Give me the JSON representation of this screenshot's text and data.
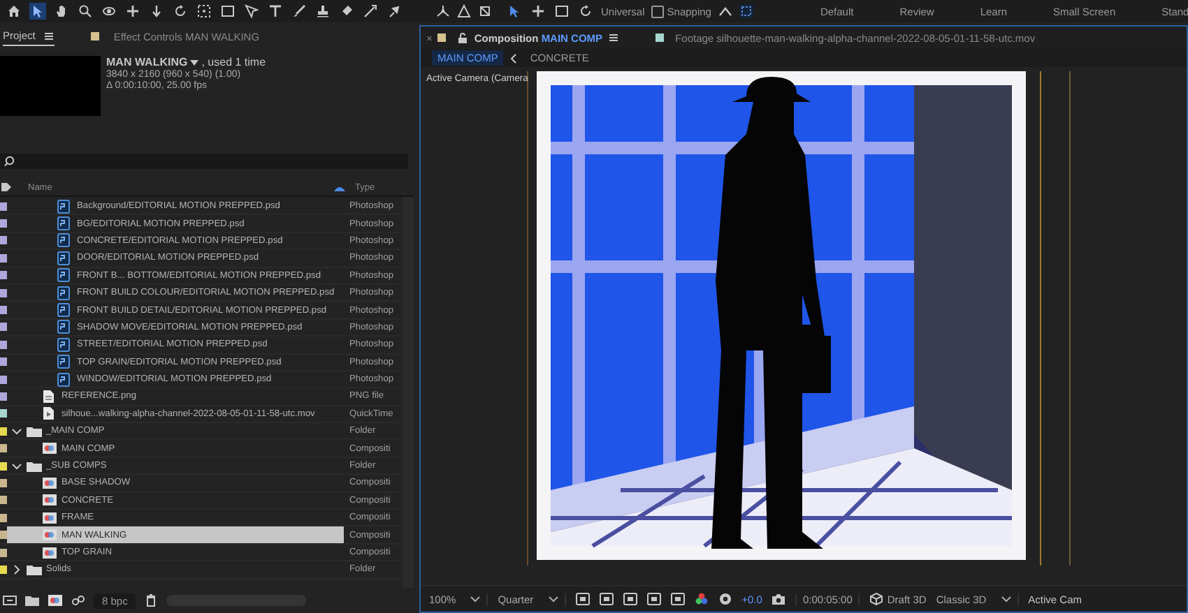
{
  "toolbar": {
    "tools": [
      {
        "selected": false
      },
      {
        "selected": true
      },
      {
        "selected": false
      },
      {
        "selected": false
      },
      {
        "selected": false
      },
      {
        "selected": false
      },
      {
        "selected": false
      },
      {
        "selected": false
      },
      {
        "selected": false
      },
      {
        "selected": false
      },
      {
        "selected": false
      },
      {
        "selected": false
      },
      {
        "selected": false
      },
      {
        "selected": false
      },
      {
        "selected": false
      },
      {
        "selected": false
      },
      {
        "selected": false
      }
    ],
    "view_tools": [
      {
        "selected": true
      },
      {
        "selected": false
      },
      {
        "selected": false
      },
      {
        "selected": false
      }
    ],
    "axis_mode": "Universal",
    "snapping": {
      "label": "Snapping",
      "checked": false
    },
    "workspaces": [
      "Default",
      "Review",
      "Learn",
      "Small Screen",
      "Stand"
    ]
  },
  "project_panel": {
    "tabs": [
      {
        "label": "Project",
        "selected": true
      },
      {
        "label": "Effect Controls MAN WALKING",
        "selected": false
      }
    ],
    "info": {
      "name": "MAN WALKING",
      "usage": ", used 1 time",
      "dimensions": "3840 x 2160  (960 x 540) (1.00)",
      "duration": "Δ 0:00:10:00, 25.00 fps"
    },
    "columns": [
      "Name",
      "Type"
    ],
    "tree": [
      {
        "children": [
          {
            "children": [
              {
                "name": "Background/EDITORIAL MOTION PREPPED.psd",
                "type": "Photoshop",
                "kind": "psd",
                "color": "#b0a6dc",
                "selected": false
              },
              {
                "name": "BG/EDITORIAL MOTION PREPPED.psd",
                "type": "Photoshop",
                "kind": "psd",
                "color": "#b0a6dc",
                "selected": false
              },
              {
                "name": "CONCRETE/EDITORIAL MOTION PREPPED.psd",
                "type": "Photoshop",
                "kind": "psd",
                "color": "#b0a6dc",
                "selected": false
              },
              {
                "name": "DOOR/EDITORIAL MOTION PREPPED.psd",
                "type": "Photoshop",
                "kind": "psd",
                "color": "#b0a6dc",
                "selected": false
              },
              {
                "name": "FRONT B... BOTTOM/EDITORIAL MOTION PREPPED.psd",
                "type": "Photoshop",
                "kind": "psd",
                "color": "#b0a6dc",
                "selected": false
              },
              {
                "name": "FRONT BUILD COLOUR/EDITORIAL MOTION PREPPED.psd",
                "type": "Photoshop",
                "kind": "psd",
                "color": "#b0a6dc",
                "selected": false
              },
              {
                "name": "FRONT BUILD DETAIL/EDITORIAL MOTION PREPPED.psd",
                "type": "Photoshop",
                "kind": "psd",
                "color": "#b0a6dc",
                "selected": false
              },
              {
                "name": "SHADOW MOVE/EDITORIAL MOTION PREPPED.psd",
                "type": "Photoshop",
                "kind": "psd",
                "color": "#b0a6dc",
                "selected": false
              },
              {
                "name": "STREET/EDITORIAL MOTION PREPPED.psd",
                "type": "Photoshop",
                "kind": "psd",
                "color": "#b0a6dc",
                "selected": false
              },
              {
                "name": "TOP GRAIN/EDITORIAL MOTION PREPPED.psd",
                "type": "Photoshop",
                "kind": "psd",
                "color": "#b0a6dc",
                "selected": false
              },
              {
                "name": "WINDOW/EDITORIAL MOTION PREPPED.psd",
                "type": "Photoshop",
                "kind": "psd",
                "color": "#b0a6dc",
                "selected": false
              }
            ]
          },
          {
            "name": "REFERENCE.png",
            "type": "PNG file",
            "kind": "png",
            "color": "#b0a6dc",
            "selected": false
          },
          {
            "name": "silhoue...walking-alpha-channel-2022-08-05-01-11-58-utc.mov",
            "type": "QuickTime",
            "kind": "mov",
            "color": "#a6d6cf",
            "selected": false
          }
        ]
      },
      {
        "name": "_MAIN COMP",
        "type": "Folder",
        "kind": "folder",
        "color": "#e6d94f",
        "selected": false,
        "expanded": true,
        "children": [
          {
            "name": "MAIN COMP",
            "type": "Compositi",
            "kind": "comp",
            "color": "#c9b68f",
            "selected": false
          }
        ]
      },
      {
        "name": "_SUB COMPS",
        "type": "Folder",
        "kind": "folder",
        "color": "#e6d94f",
        "selected": false,
        "expanded": true,
        "children": [
          {
            "name": "BASE SHADOW",
            "type": "Compositi",
            "kind": "comp",
            "color": "#c9b68f",
            "selected": false
          },
          {
            "name": "CONCRETE",
            "type": "Compositi",
            "kind": "comp",
            "color": "#c9b68f",
            "selected": false
          },
          {
            "name": "FRAME",
            "type": "Compositi",
            "kind": "comp",
            "color": "#c9b68f",
            "selected": false
          },
          {
            "name": "MAN WALKING",
            "type": "Compositi",
            "kind": "comp",
            "color": "#c9b68f",
            "selected": true
          },
          {
            "name": "TOP GRAIN",
            "type": "Compositi",
            "kind": "comp",
            "color": "#c9b68f",
            "selected": false
          }
        ]
      },
      {
        "name": "Solids",
        "type": "Folder",
        "kind": "folder",
        "color": "#e6d94f",
        "selected": false,
        "expanded": false
      }
    ],
    "footer": {
      "bit_depth": "8 bpc"
    }
  },
  "composition_panel": {
    "tabs": [
      {
        "close": "×",
        "prefix": "Composition",
        "name": "MAIN COMP",
        "selected": true
      },
      {
        "prefix": "Footage",
        "name": "silhouette-man-walking-alpha-channel-2022-08-05-01-11-58-utc.mov",
        "selected": false
      }
    ],
    "breadcrumbs": [
      {
        "label": "MAIN COMP",
        "selected": true
      },
      {
        "label": "CONCRETE",
        "selected": false
      }
    ],
    "viewer": {
      "camera_label": "Active Camera (Camera"
    },
    "controls": {
      "magnification": "100%",
      "resolution": "Quarter",
      "exposure": "+0.0",
      "timecode": "0:00:05:00",
      "renderer": "Draft 3D",
      "renderer_mode": "Classic 3D",
      "camera_view": "Active Cam"
    }
  }
}
